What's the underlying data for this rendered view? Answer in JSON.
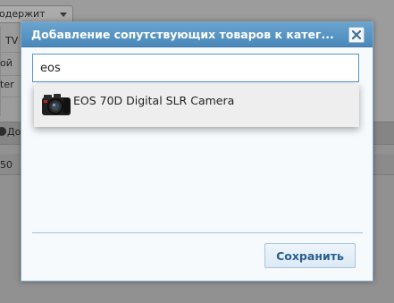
{
  "background": {
    "select_value": "одержит",
    "labels": [
      "TV",
      "ой",
      "ter",
      "До",
      "50"
    ]
  },
  "dialog": {
    "title": "Добавление сопутствующих товаров к катег...",
    "close_symbol": "×",
    "search": {
      "value": "eos",
      "placeholder": ""
    },
    "suggestions": [
      {
        "label": "EOS 70D Digital SLR Camera",
        "icon": "camera-thumbnail"
      }
    ],
    "save_label": "Сохранить"
  },
  "colors": {
    "header": "#4a88ba",
    "save_text": "#2a5f8f"
  }
}
